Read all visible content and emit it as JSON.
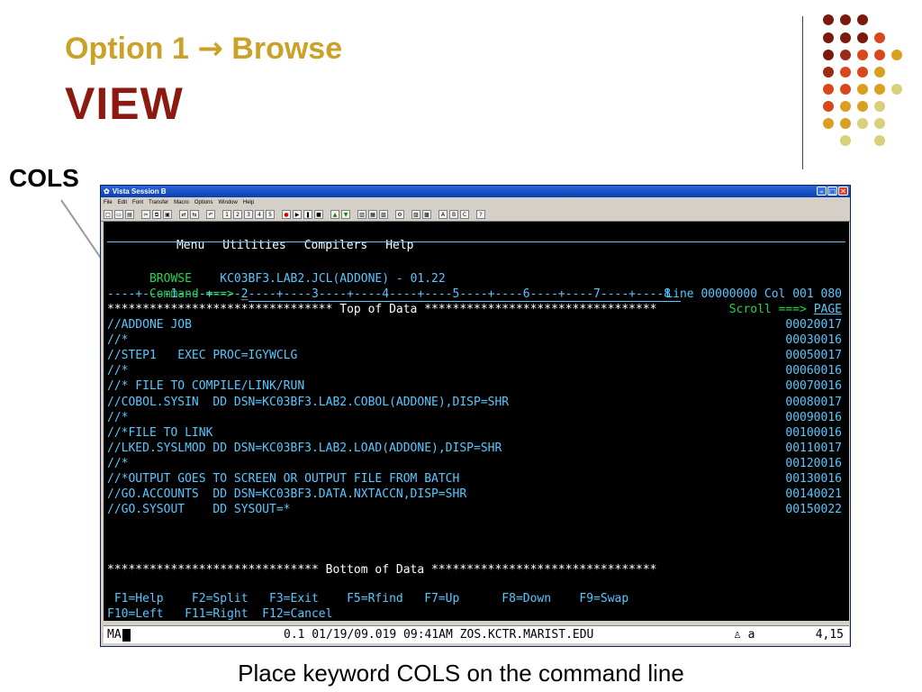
{
  "slide": {
    "title": "Option 1",
    "title_arrow": "→",
    "title_rest": "Browse",
    "subtitle": "VIEW",
    "cols_label": "COLS",
    "caption": "Place keyword  COLS on the command line"
  },
  "window": {
    "title": "Vista Session B",
    "menu": [
      "File",
      "Edit",
      "Font",
      "Transfer",
      "Macro",
      "Options",
      "Window",
      "Help"
    ],
    "toolbar_icons": [
      "new-icon",
      "open-icon",
      "print-icon",
      "cut-icon",
      "copy-icon",
      "paste-icon",
      "connect-icon",
      "disconnect-icon",
      "undo-icon",
      "macro-1-icon",
      "macro-2-icon",
      "macro-3-icon",
      "macro-4-icon",
      "macro-5-icon",
      "record-icon",
      "play-icon",
      "pause-icon",
      "stop-icon",
      "up-icon",
      "down-icon",
      "send-icon",
      "receive-icon",
      "keyboard-icon",
      "settings-icon",
      "clipboard-icon",
      "key-a-icon",
      "key-b-icon",
      "key-c-icon",
      "help-icon"
    ],
    "toolbar_labels": {
      "a": "A",
      "b": "B",
      "c": "C",
      "help": "?"
    }
  },
  "terminal": {
    "menu": [
      "Menu",
      "Utilities",
      "Compilers",
      "Help"
    ],
    "browse_label": "BROWSE",
    "dataset": "KC03BF3.LAB2.JCL(ADDONE) - 01.22",
    "line_info": "Line 00000000 Col 001 080",
    "command_label": "Command ===>",
    "command_value": "_",
    "scroll_label": "Scroll ===>",
    "scroll_value": "PAGE",
    "ruler": "----+----1----+----2----+----3----+----4----+----5----+----6----+----7----+----8",
    "top_of_data": "******************************** Top of Data *********************************",
    "lines": [
      {
        "text": "//ADDONE JOB",
        "seq": "00020017"
      },
      {
        "text": "//*",
        "seq": "00030016"
      },
      {
        "text": "//STEP1   EXEC PROC=IGYWCLG",
        "seq": "00050017"
      },
      {
        "text": "//*",
        "seq": "00060016"
      },
      {
        "text": "//* FILE TO COMPILE/LINK/RUN",
        "seq": "00070016"
      },
      {
        "text": "//COBOL.SYSIN  DD DSN=KC03BF3.LAB2.COBOL(ADDONE),DISP=SHR",
        "seq": "00080017"
      },
      {
        "text": "//*",
        "seq": "00090016"
      },
      {
        "text": "//*FILE TO LINK",
        "seq": "00100016"
      },
      {
        "text": "//LKED.SYSLMOD DD DSN=KC03BF3.LAB2.LOAD(ADDONE),DISP=SHR",
        "seq": "00110017"
      },
      {
        "text": "//*",
        "seq": "00120016"
      },
      {
        "text": "//*OUTPUT GOES TO SCREEN OR OUTPUT FILE FROM BATCH",
        "seq": "00130016"
      },
      {
        "text": "//GO.ACCOUNTS  DD DSN=KC03BF3.DATA.NXTACCN,DISP=SHR",
        "seq": "00140021"
      },
      {
        "text": "//GO.SYSOUT    DD SYSOUT=*",
        "seq": "00150022"
      }
    ],
    "bottom_of_data": "****************************** Bottom of Data ********************************",
    "pf_row1": " F1=Help    F2=Split   F3=Exit    F5=Rfind   F7=Up      F8=Down    F9=Swap",
    "pf_row2": "F10=Left   F11=Right  F12=Cancel"
  },
  "statusbar": {
    "mode": "MA",
    "info": "0.1 01/19/09.019 09:41AM ZOS.KCTR.MARIST.EDU",
    "session": "a",
    "cursor_pos": "4,15"
  },
  "colors": {
    "title_gold": "#c9a227",
    "subtitle_red": "#8b1a10",
    "terminal_blue": "#58c8ff",
    "terminal_green": "#1fd850"
  }
}
